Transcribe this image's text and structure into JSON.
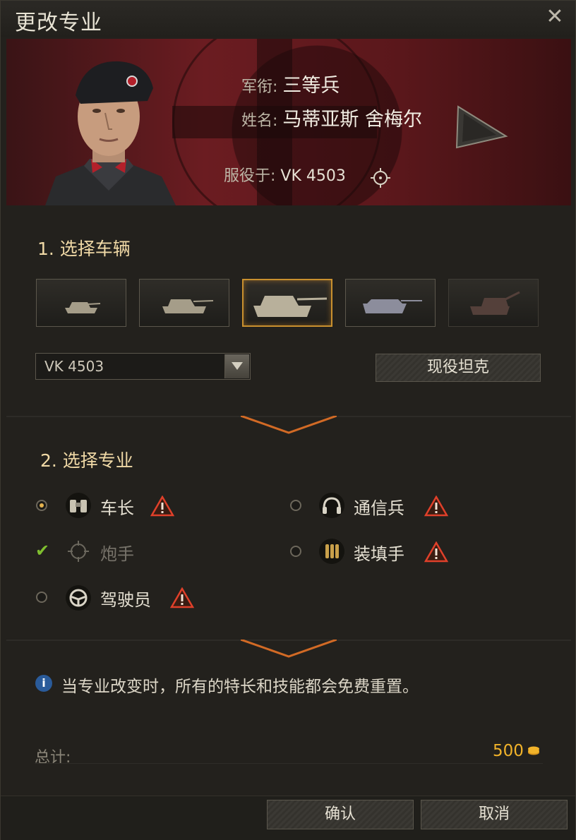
{
  "window": {
    "title": "更改专业"
  },
  "crew": {
    "rank_label": "军衔:",
    "rank_value": "三等兵",
    "name_label": "姓名:",
    "name_value": "马蒂亚斯 舍梅尔",
    "served_label": "服役于:",
    "served_value": "VK 4503"
  },
  "step1": {
    "title": "1. 选择车辆",
    "tanks": [
      {
        "icon": "light-tank-icon",
        "state": "normal"
      },
      {
        "icon": "medium-tank-icon",
        "state": "normal"
      },
      {
        "icon": "heavy-tank-icon",
        "state": "selected"
      },
      {
        "icon": "tank-destroyer-icon",
        "state": "normal"
      },
      {
        "icon": "spg-icon",
        "state": "dim"
      }
    ],
    "vehicle_select": "VK 4503",
    "current_tank_button": "现役坦克"
  },
  "step2": {
    "title": "2. 选择专业",
    "roles": [
      {
        "label": "车长",
        "icon": "binoculars-icon",
        "state": "selected",
        "warning": true
      },
      {
        "label": "通信兵",
        "icon": "headphones-icon",
        "state": "unselected",
        "warning": true
      },
      {
        "label": "炮手",
        "icon": "crosshair-icon",
        "state": "current",
        "warning": false
      },
      {
        "label": "装填手",
        "icon": "shells-icon",
        "state": "unselected",
        "warning": true
      },
      {
        "label": "驾驶员",
        "icon": "steering-wheel-icon",
        "state": "unselected",
        "warning": true
      }
    ]
  },
  "notice": "当专业改变时，所有的特长和技能都会免费重置。",
  "total": {
    "label": "总计:",
    "value": "500",
    "currency_icon": "gold-icon"
  },
  "buttons": {
    "confirm": "确认",
    "cancel": "取消"
  },
  "colors": {
    "accent": "#c9902e",
    "gold": "#f1b32a",
    "warning": "#e0402a",
    "check": "#7fbf2f",
    "section_title": "#f0d9a6"
  }
}
